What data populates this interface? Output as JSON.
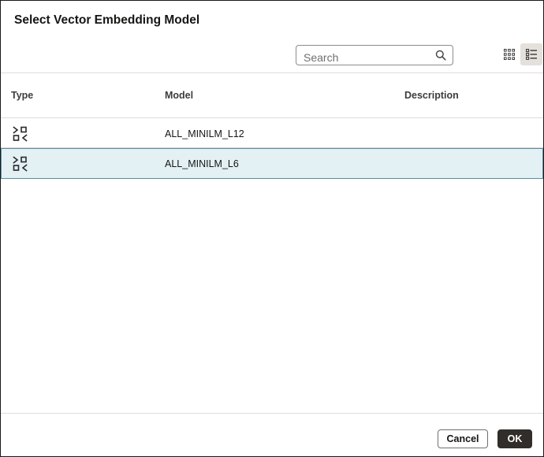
{
  "dialog": {
    "title": "Select Vector Embedding Model"
  },
  "search": {
    "placeholder": "Search",
    "value": "",
    "icon": "search-icon"
  },
  "view_toggle": {
    "grid_icon": "grid-view-icon",
    "list_icon": "list-view-icon",
    "active": "list"
  },
  "table": {
    "columns": [
      "Type",
      "Model",
      "Description"
    ],
    "rows": [
      {
        "type_icon": "embedding-model-icon",
        "model": "ALL_MINILM_L12",
        "description": "",
        "selected": false
      },
      {
        "type_icon": "embedding-model-icon",
        "model": "ALL_MINILM_L6",
        "description": "",
        "selected": true
      }
    ]
  },
  "footer": {
    "cancel_label": "Cancel",
    "ok_label": "OK"
  },
  "colors": {
    "selected_row_bg": "#e3f0f4",
    "selected_row_border": "#5a8e9c",
    "primary_button": "#312d2a"
  }
}
